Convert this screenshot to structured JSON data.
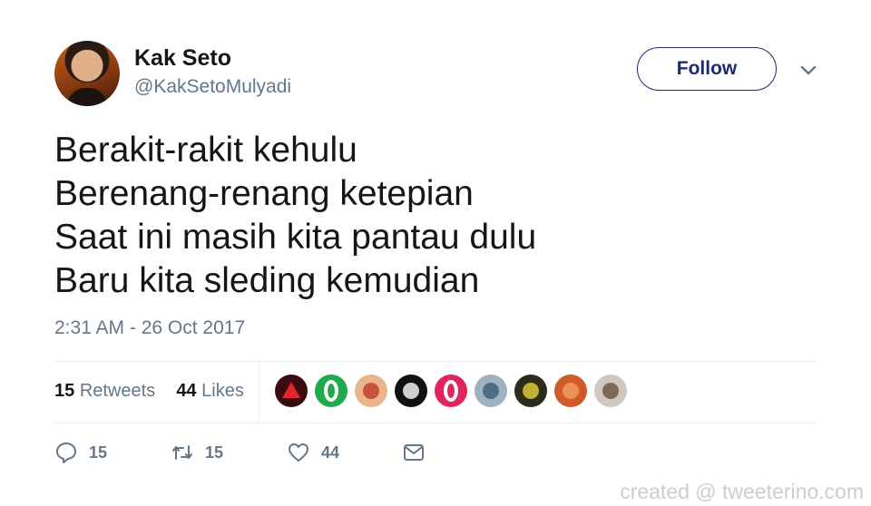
{
  "user": {
    "name": "Kak Seto",
    "handle": "@KakSetoMulyadi"
  },
  "follow_label": "Follow",
  "tweet": {
    "lines": [
      "Berakit-rakit kehulu",
      "Berenang-renang ketepian",
      "Saat ini masih kita pantau dulu",
      "Baru kita sleding kemudian"
    ],
    "timestamp": "2:31 AM - 26 Oct 2017"
  },
  "stats": {
    "retweets_count": "15",
    "retweets_label": "Retweets",
    "likes_count": "44",
    "likes_label": "Likes"
  },
  "likers": [
    {
      "icon": "red-triangle-avatar",
      "bg": "#3a0b10",
      "fg": "#e3262b"
    },
    {
      "icon": "green-ring-avatar",
      "bg": "#1faa4d",
      "fg": "#ffffff"
    },
    {
      "icon": "glasses-face-avatar",
      "bg": "#e8b48c",
      "fg": "#c0392b"
    },
    {
      "icon": "dark-face-avatar",
      "bg": "#111111",
      "fg": "#ffffff"
    },
    {
      "icon": "pink-ring-avatar",
      "bg": "#e3245b",
      "fg": "#ffffff"
    },
    {
      "icon": "blue-figure-avatar",
      "bg": "#9fb2c0",
      "fg": "#3f5a78"
    },
    {
      "icon": "yellow-sign-avatar",
      "bg": "#2c2c1a",
      "fg": "#e7d23a"
    },
    {
      "icon": "orange-photo-avatar",
      "bg": "#d05a2a",
      "fg": "#f0a060"
    },
    {
      "icon": "grey-figure-avatar",
      "bg": "#cfc8c0",
      "fg": "#6a5040"
    }
  ],
  "actions": {
    "reply_count": "15",
    "retweet_count": "15",
    "like_count": "44"
  },
  "watermark": "created @ tweeterino.com"
}
